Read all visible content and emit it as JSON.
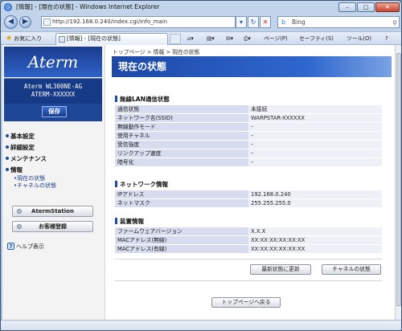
{
  "browser": {
    "window_title": "[情報] - [現在の状態] - Windows Internet Explorer",
    "address": "http://192.168.0.240/index.cgi/info_main",
    "search_text": "Bing",
    "favorites_label": "お気に入り",
    "tab_title": "[情報] - [現在の状態]",
    "commands": {
      "page": "ページ(P)",
      "safety": "セーフティ(S)",
      "tools": "ツール(O)",
      "help_mark": "?"
    },
    "win_buttons": {
      "minimize": "–",
      "maximize": "□",
      "close": "✕"
    }
  },
  "sidebar": {
    "logo": "Aterm",
    "model_line1": "Aterm WL300NE-AG",
    "model_line2": "ATERM-XXXXXX",
    "save_label": "保存",
    "menu": [
      {
        "label": "基本設定"
      },
      {
        "label": "詳細設定"
      },
      {
        "label": "メンテナンス"
      },
      {
        "label": "情報"
      }
    ],
    "submenu": [
      {
        "label": "•現在の状態"
      },
      {
        "label": "•チャネルの状態"
      }
    ],
    "aterm_station_label": "AtermStation",
    "register_label": "お客様登録",
    "help_label": "ヘルプ表示"
  },
  "main": {
    "breadcrumb": "トップページ > 情報 > 現在の状態",
    "title": "現在の状態",
    "wireless_heading": "無線LAN通信状態",
    "wireless_rows": [
      {
        "k": "通信状態",
        "v": "未接続"
      },
      {
        "k": "ネットワーク名(SSID)",
        "v": "WARPSTAR-XXXXXX"
      },
      {
        "k": "無線動作モード",
        "v": "–"
      },
      {
        "k": "使用チャネル",
        "v": "–"
      },
      {
        "k": "受信強度",
        "v": "–"
      },
      {
        "k": "リンクアップ速度",
        "v": "–"
      },
      {
        "k": "暗号化",
        "v": "–"
      }
    ],
    "network_heading": "ネットワーク情報",
    "network_rows": [
      {
        "k": "IPアドレス",
        "v": "192.168.0.240"
      },
      {
        "k": "ネットマスク",
        "v": "255.255.255.0"
      }
    ],
    "device_heading": "装置情報",
    "device_rows": [
      {
        "k": "ファームウェアバージョン",
        "v": "X.X.X"
      },
      {
        "k": "MACアドレス(無線)",
        "v": "XX:XX:XX:XX:XX:XX"
      },
      {
        "k": "MACアドレス(有線)",
        "v": "XX:XX:XX:XX:XX:XX"
      }
    ],
    "refresh_label": "最新状態に更新",
    "channel_label": "チャネルの状態",
    "top_label": "トップページへ戻る"
  }
}
